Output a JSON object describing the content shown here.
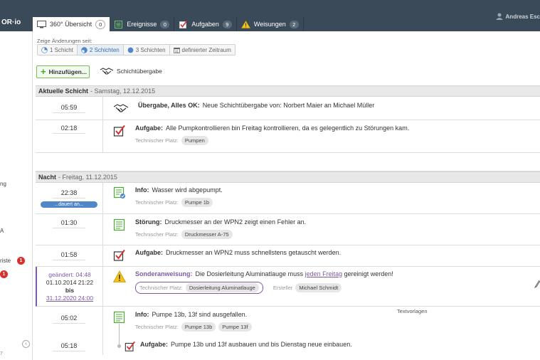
{
  "app": {
    "brand": "OR·io",
    "user": "Andreas Esc"
  },
  "tabs": [
    {
      "label": "360° Übersicht",
      "count": "0",
      "icon": "monitor-icon"
    },
    {
      "label": "Ereignisse",
      "count": "0",
      "icon": "list-icon"
    },
    {
      "label": "Aufgaben",
      "count": "9",
      "icon": "checkbox-icon"
    },
    {
      "label": "Weisungen",
      "count": "2",
      "icon": "warning-icon"
    }
  ],
  "sidebar": {
    "fragments": [
      "ng",
      "A",
      "riste",
      ""
    ],
    "badges": [
      "1",
      "1"
    ],
    "version": "7"
  },
  "filter": {
    "label": "Zeige Änderungen seit:",
    "options": [
      "1 Schicht",
      "2 Schichten",
      "3 Schichten",
      "definierter Zeitraum"
    ],
    "active": "2 Schichten"
  },
  "actions": {
    "add": "Hinzufügen...",
    "handover": "Schichtübergabe"
  },
  "sections": [
    {
      "title": "Aktuelle Schicht",
      "date": "- Samstag, 12.12.2015",
      "rows": [
        {
          "time": "05:59",
          "type": "Übergabe, Alles OK:",
          "text": "Neue Schichtübergabe von: Norbert Maier an Michael Müller",
          "tag_label": "",
          "tags": []
        },
        {
          "time": "02:18",
          "type": "Aufgabe:",
          "text": "Alle Pumpkontrollieren bin Freitag kontrollieren, da es gelegentlich zu Störungen kam.",
          "tag_label": "Technischer Platz:",
          "tags": [
            "Pumpen"
          ]
        }
      ]
    },
    {
      "title": "Nacht",
      "date": "- Freitag, 11.12.2015",
      "rows": [
        {
          "time": "22:38",
          "running": "...dauert an...",
          "type": "Info:",
          "text": "Wasser wird abgepumpt.",
          "tag_label": "Technischer Platz:",
          "tags": [
            "Pumpe 1b"
          ]
        },
        {
          "time": "01:30",
          "type": "Störung:",
          "text": "Druckmesser an der WPN2 zeigt einen Fehler an.",
          "tag_label": "Technischer Platz:",
          "tags": [
            "Druckmesser A-75"
          ]
        },
        {
          "time": "01:58",
          "type": "Aufgabe:",
          "text": "Druckmesser an  WPN2 muss schnellstens getauscht werden.",
          "tag_label": "",
          "tags": []
        },
        {
          "changed": "geändert: 04:48",
          "from": "01.10.2014 21:22",
          "bis": "bis",
          "to": "31.12.2020 24:00",
          "type": "Sonderanweisung:",
          "text_pre": "Die Dosierleitung Aluminatlauge muss",
          "link": "jeden Freitag",
          "text_post": "gereinigt werden!",
          "tag_label": "Technischer Platz:",
          "tags": [
            "Dosierleitung Aluminatlauge"
          ],
          "creator_label": "Ersteller",
          "creator": "Michael Schmidt"
        },
        {
          "time": "05:02",
          "type": "Info:",
          "text": "Pumpe 13b, 13f sind ausgefallen.",
          "tag_label": "Technischer Platz:",
          "tags": [
            "Pumpe 13b",
            "Pumpe 13f"
          ],
          "aside": "Textvorlagen"
        },
        {
          "time": "05:18",
          "type": "Aufgabe:",
          "text": "Pumpe 13b und 13f ausbauen und bis Dienstag neue einbauen.",
          "tag_label": "",
          "tags": []
        }
      ]
    }
  ],
  "colors": {
    "topbar": "#3b4a58",
    "accent_purple": "#7f5aa8",
    "accent_blue": "#5087c8",
    "task_red": "#d9302c",
    "add_green": "#4aa832"
  }
}
